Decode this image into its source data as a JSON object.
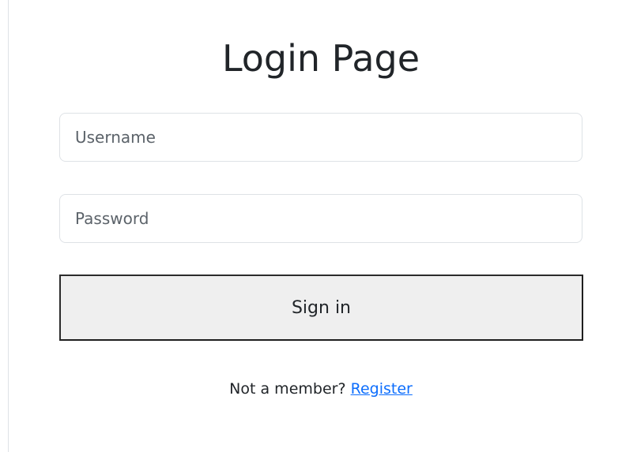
{
  "page": {
    "title": "Login Page"
  },
  "form": {
    "username_placeholder": "Username",
    "username_value": "",
    "password_placeholder": "Password",
    "password_value": "",
    "submit_label": "Sign in"
  },
  "footer": {
    "prompt_text": "Not a member?",
    "register_link_text": "Register"
  },
  "colors": {
    "link": "#0d6efd",
    "text": "#212529",
    "button_background": "#efefef",
    "field_border": "#dee2e6"
  }
}
